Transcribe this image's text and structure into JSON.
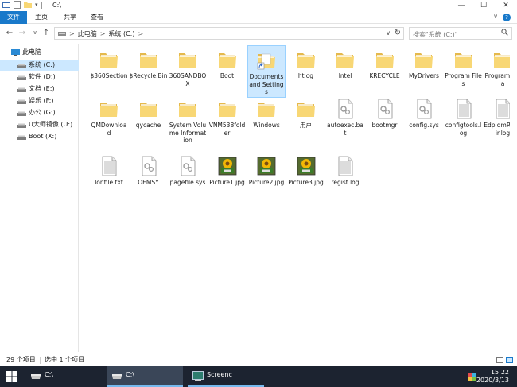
{
  "window": {
    "title": "C:\\",
    "minimize": "—",
    "maximize": "☐",
    "close": "✕"
  },
  "ribbon": {
    "tabs": [
      "文件",
      "主页",
      "共享",
      "查看"
    ],
    "collapse": "∨",
    "help": "?"
  },
  "address": {
    "back": "←",
    "forward": "→",
    "recent": "∨",
    "up": "↑",
    "crumbs": [
      "此电脑",
      "系统 (C:)"
    ],
    "sep": ">",
    "dropdown": "∨",
    "refresh": "↻",
    "search_placeholder": "搜索\"系统 (C:)\""
  },
  "navpane": {
    "items": [
      {
        "label": "此电脑",
        "icon": "computer-icon"
      },
      {
        "label": "系统 (C:)",
        "icon": "drive-icon"
      },
      {
        "label": "软件 (D:)",
        "icon": "drive-icon"
      },
      {
        "label": "文档 (E:)",
        "icon": "drive-icon"
      },
      {
        "label": "娱乐 (F:)",
        "icon": "drive-icon"
      },
      {
        "label": "办公 (G:)",
        "icon": "drive-icon"
      },
      {
        "label": "U大师镜像 (U:)",
        "icon": "drive-icon"
      },
      {
        "label": "Boot (X:)",
        "icon": "drive-icon"
      }
    ],
    "selected_index": 1
  },
  "files": [
    {
      "name": "$360Section",
      "type": "folder"
    },
    {
      "name": "$Recycle.Bin",
      "type": "folder"
    },
    {
      "name": "360SANDBOX",
      "type": "folder"
    },
    {
      "name": "Boot",
      "type": "folder"
    },
    {
      "name": "Documents and Settings",
      "type": "shortcut-folder",
      "selected": true
    },
    {
      "name": "htlog",
      "type": "folder"
    },
    {
      "name": "Intel",
      "type": "folder"
    },
    {
      "name": "KRECYCLE",
      "type": "folder"
    },
    {
      "name": "MyDrivers",
      "type": "folder"
    },
    {
      "name": "Program Files",
      "type": "folder"
    },
    {
      "name": "ProgramData",
      "type": "folder"
    },
    {
      "name": "QMDownload",
      "type": "folder"
    },
    {
      "name": "qycache",
      "type": "folder"
    },
    {
      "name": "System Volume Information",
      "type": "folder"
    },
    {
      "name": "VNM538folder",
      "type": "folder"
    },
    {
      "name": "Windows",
      "type": "folder"
    },
    {
      "name": "用户",
      "type": "folder"
    },
    {
      "name": "autoexec.bat",
      "type": "system-file"
    },
    {
      "name": "bootmgr",
      "type": "system-file"
    },
    {
      "name": "config.sys",
      "type": "system-file"
    },
    {
      "name": "configtools.log",
      "type": "text-file"
    },
    {
      "name": "EdpIdmRepair.log",
      "type": "text-file"
    },
    {
      "name": "lonfile.txt",
      "type": "text-file"
    },
    {
      "name": "OEMSY",
      "type": "system-file"
    },
    {
      "name": "pagefile.sys",
      "type": "system-file"
    },
    {
      "name": "Picture1.jpg",
      "type": "image-file"
    },
    {
      "name": "Picture2.jpg",
      "type": "image-file"
    },
    {
      "name": "Picture3.jpg",
      "type": "image-file"
    },
    {
      "name": "regist.log",
      "type": "text-file"
    }
  ],
  "status": {
    "count": "29 个项目",
    "selection": "选中 1 个项目"
  },
  "taskbar": {
    "tasks": [
      {
        "label": "C:\\",
        "active": false
      },
      {
        "label": "C:\\",
        "active": true
      },
      {
        "label": "Screenc",
        "active": false
      }
    ],
    "time": "15:22",
    "date": "2020/3/13"
  },
  "colors": {
    "accent": "#1979ca",
    "selection": "#cce8ff",
    "folder": "#f8d775",
    "taskbar": "#1c2330"
  }
}
